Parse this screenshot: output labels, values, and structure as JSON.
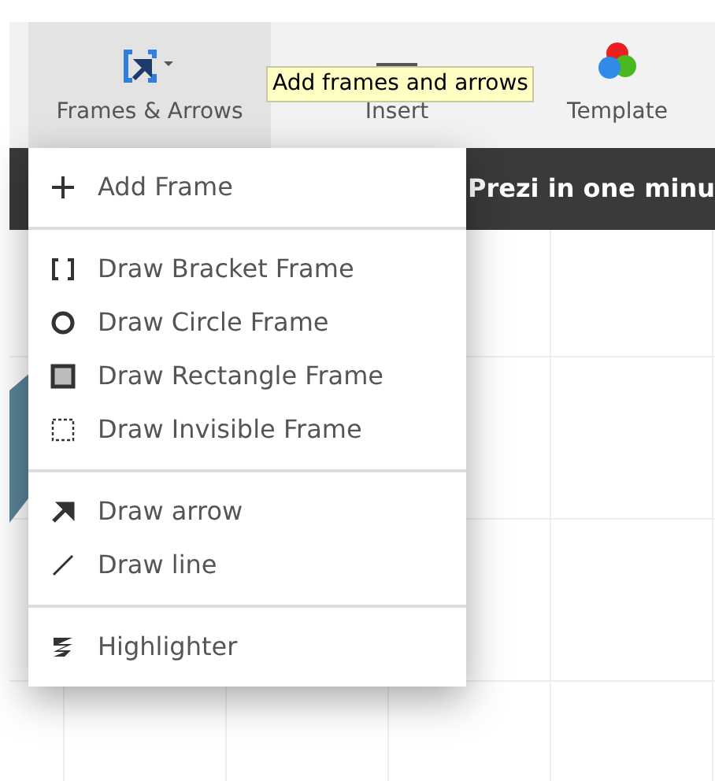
{
  "toolbar": {
    "buttons": [
      {
        "label": "Frames & Arrows",
        "kind": "frames",
        "selected": true
      },
      {
        "label": "Insert",
        "kind": "insert",
        "selected": false
      },
      {
        "label": "Template",
        "kind": "template",
        "selected": false
      }
    ]
  },
  "tooltip": "Add frames and arrows",
  "banner": {
    "title": "Prezi in one minu"
  },
  "menu": {
    "groups": [
      {
        "items": [
          {
            "label": "Add Frame",
            "kind": "plus"
          }
        ]
      },
      {
        "items": [
          {
            "label": "Draw Bracket Frame",
            "kind": "bracket"
          },
          {
            "label": "Draw Circle Frame",
            "kind": "circle"
          },
          {
            "label": "Draw Rectangle Frame",
            "kind": "rectangle"
          },
          {
            "label": "Draw Invisible Frame",
            "kind": "invisible"
          }
        ]
      },
      {
        "items": [
          {
            "label": "Draw arrow",
            "kind": "arrow"
          },
          {
            "label": "Draw line",
            "kind": "line"
          }
        ]
      },
      {
        "items": [
          {
            "label": "Highlighter",
            "kind": "highlighter"
          }
        ]
      }
    ]
  }
}
